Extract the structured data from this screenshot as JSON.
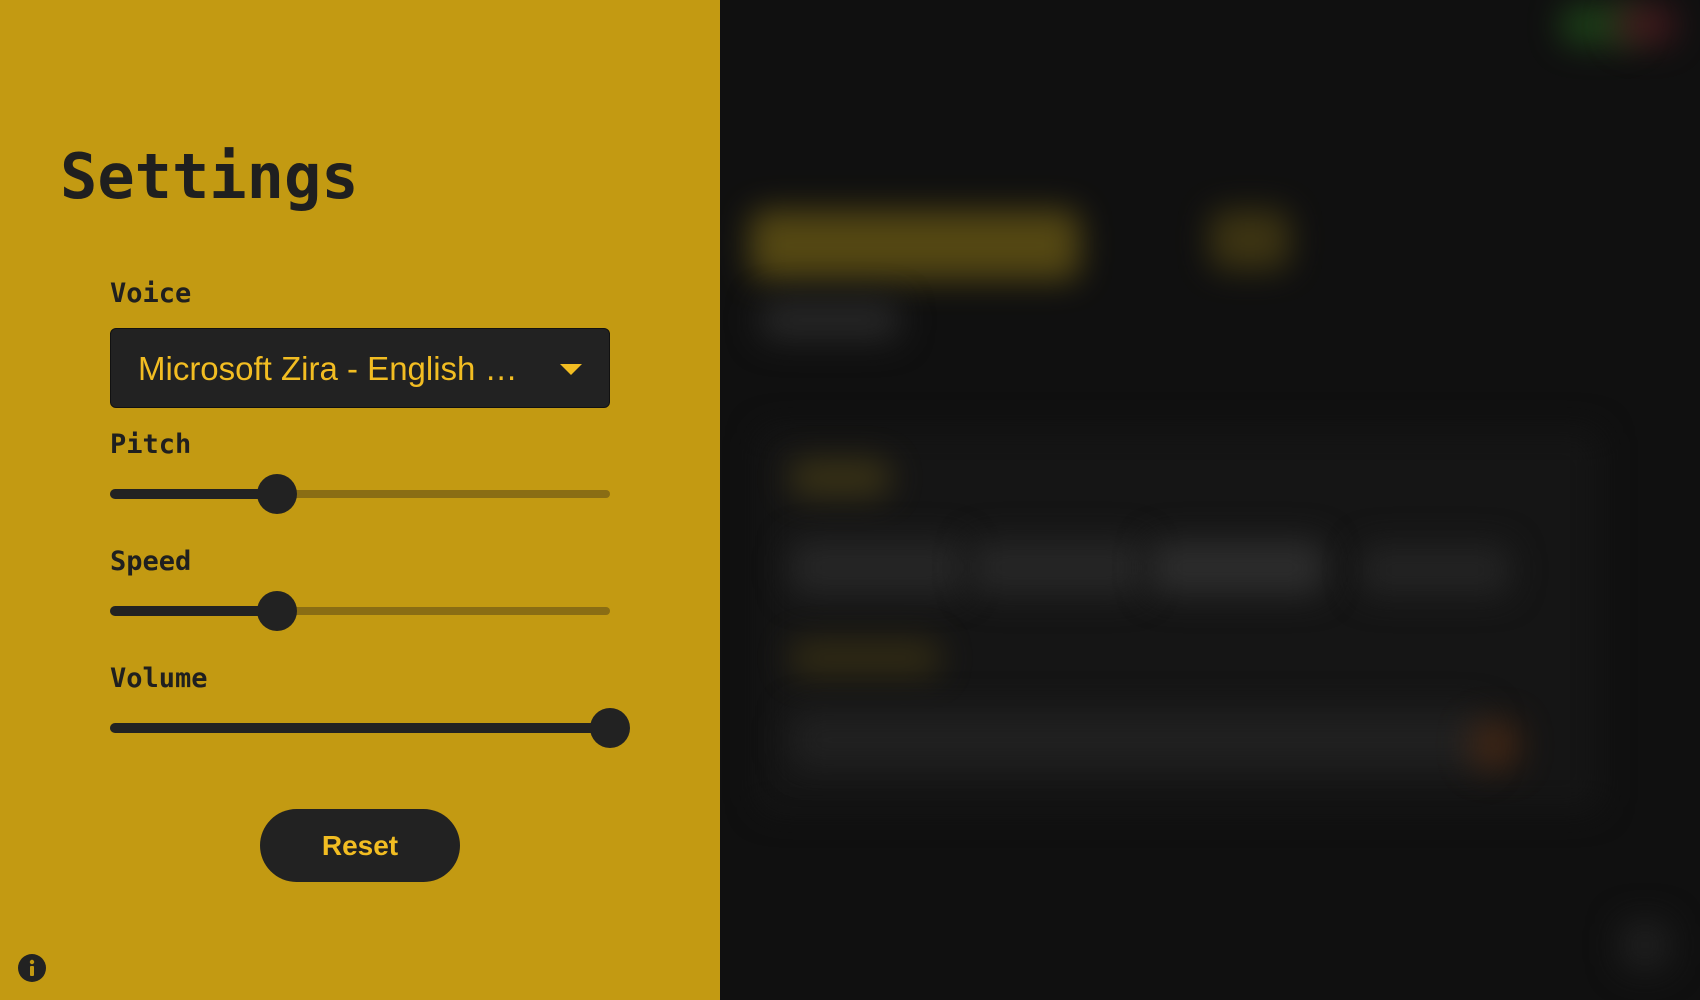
{
  "settings": {
    "title": "Settings",
    "voice": {
      "label": "Voice",
      "selected": "Microsoft Zira - English (United States)",
      "icon": "chevron-down-icon"
    },
    "pitch": {
      "label": "Pitch",
      "fraction": 0.333
    },
    "speed": {
      "label": "Speed",
      "fraction": 0.333
    },
    "volume": {
      "label": "Volume",
      "fraction": 1.0
    },
    "reset_label": "Reset",
    "info_icon": "info-icon"
  },
  "colors": {
    "panel_background": "#c39a12",
    "accent": "#f2bd22",
    "dark": "#222222",
    "track": "#8a6d14",
    "backdrop": "#101010"
  }
}
